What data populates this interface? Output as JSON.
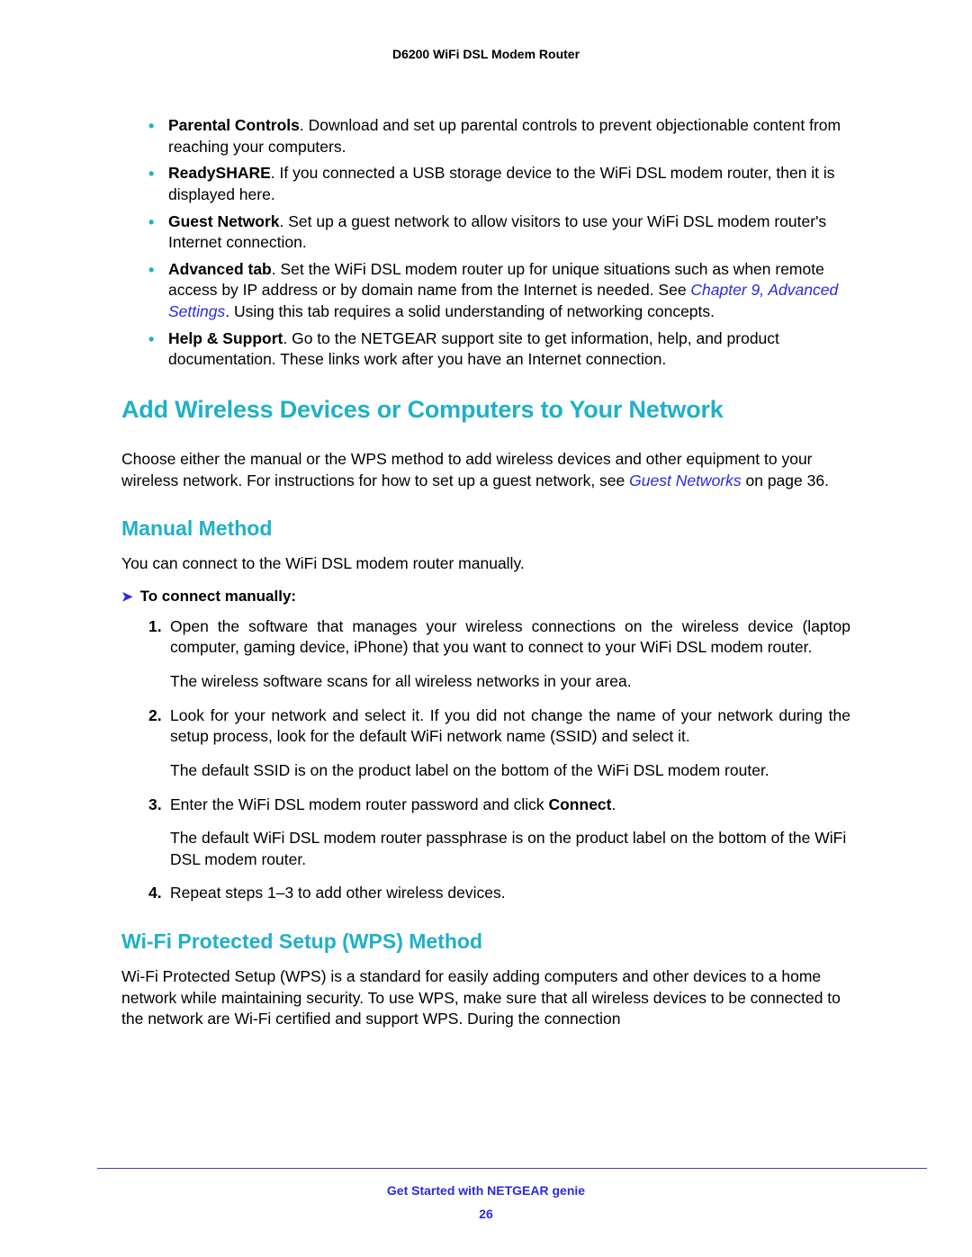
{
  "header": {
    "title": "D6200 WiFi DSL Modem Router"
  },
  "bullets": {
    "b1_lead": "Parental Controls",
    "b1_rest": ". Download and set up parental controls to prevent objectionable content from reaching your computers.",
    "b2_lead": "ReadySHARE",
    "b2_rest": ". If you connected a USB storage device to the WiFi DSL modem router, then it is displayed here.",
    "b3_lead": "Guest Network",
    "b3_rest": ". Set up a guest network to allow visitors to use your WiFi DSL modem router's Internet connection.",
    "b4_lead": "Advanced tab",
    "b4_rest_a": ". Set the WiFi DSL modem router up for unique situations such as when remote access by IP address or by domain name from the Internet is needed. See ",
    "b4_xref": "Chapter 9, Advanced Settings",
    "b4_rest_b": ". Using this tab requires a solid understanding of networking concepts.",
    "b5_lead": "Help & Support",
    "b5_rest": ". Go to the NETGEAR support site to get information, help, and product documentation. These links work after you have an Internet connection."
  },
  "h1": "Add Wireless Devices or Computers to Your Network",
  "intro_a": "Choose either the manual or the WPS method to add wireless devices and other equipment to your wireless network. For instructions for how to set up a guest network, see ",
  "intro_xref": "Guest Networks",
  "intro_b": " on page 36.",
  "h2a": "Manual Method",
  "manual_intro": "You can connect to the WiFi DSL modem router manually.",
  "proc_heading": "To connect manually:",
  "steps": {
    "s1n": "1.",
    "s1": "Open the software that manages your wireless connections on the wireless device (laptop computer, gaming device, iPhone) that you want to connect to your WiFi DSL modem router.",
    "s1f": "The wireless software scans for all wireless networks in your area.",
    "s2n": "2.",
    "s2": "Look for your network and select it. If you did not change the name of your network during the setup process, look for the default WiFi network name (SSID) and select it.",
    "s2f": "The default SSID is on the product label on the bottom of the WiFi DSL modem router.",
    "s3n": "3.",
    "s3a": "Enter the WiFi DSL modem router password and click ",
    "s3b": "Connect",
    "s3c": ".",
    "s3f": "The default WiFi DSL modem router passphrase is on the product label on the bottom of the WiFi DSL modem router.",
    "s4n": "4.",
    "s4": "Repeat steps 1–3 to add other wireless devices."
  },
  "h2b": "Wi-Fi Protected Setup (WPS) Method",
  "wps_para": "Wi-Fi Protected Setup (WPS) is a standard for easily adding computers and other devices to a home network while maintaining security. To use WPS, make sure that all wireless devices to be connected to the network are Wi-Fi certified and support WPS. During the connection",
  "footer": {
    "section": "Get Started with NETGEAR genie",
    "page": "26"
  }
}
